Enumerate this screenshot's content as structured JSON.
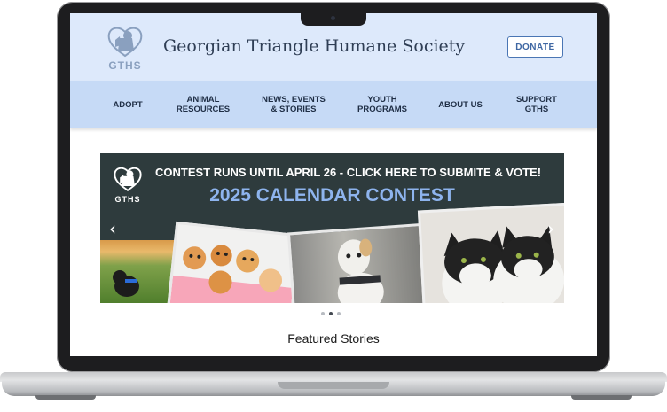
{
  "site": {
    "logo_text": "GTHS",
    "title": "Georgian Triangle Humane Society",
    "donate_label": "DONATE"
  },
  "nav": {
    "items": [
      {
        "label": "ADOPT"
      },
      {
        "label": "ANIMAL RESOURCES"
      },
      {
        "label": "NEWS, EVENTS & STORIES"
      },
      {
        "label": "YOUTH PROGRAMS"
      },
      {
        "label": "ABOUT US"
      },
      {
        "label": "SUPPORT GTHS"
      }
    ]
  },
  "banner": {
    "logo_text": "GTHS",
    "line1": "CONTEST RUNS UNTIL APRIL 26 - CLICK HERE TO SUBMITE & VOTE!",
    "title": "2025 CALENDAR CONTEST",
    "prev_icon": "chevron-left-icon",
    "next_icon": "chevron-right-icon",
    "slides_total": 3,
    "active_slide": 2
  },
  "featured": {
    "heading": "Featured Stories"
  },
  "colors": {
    "header_bg": "#dde9fb",
    "nav_bg": "#c6daf6",
    "banner_bg": "#2e3b3d",
    "banner_title": "#8eb4ee",
    "accent": "#3f67a3"
  }
}
